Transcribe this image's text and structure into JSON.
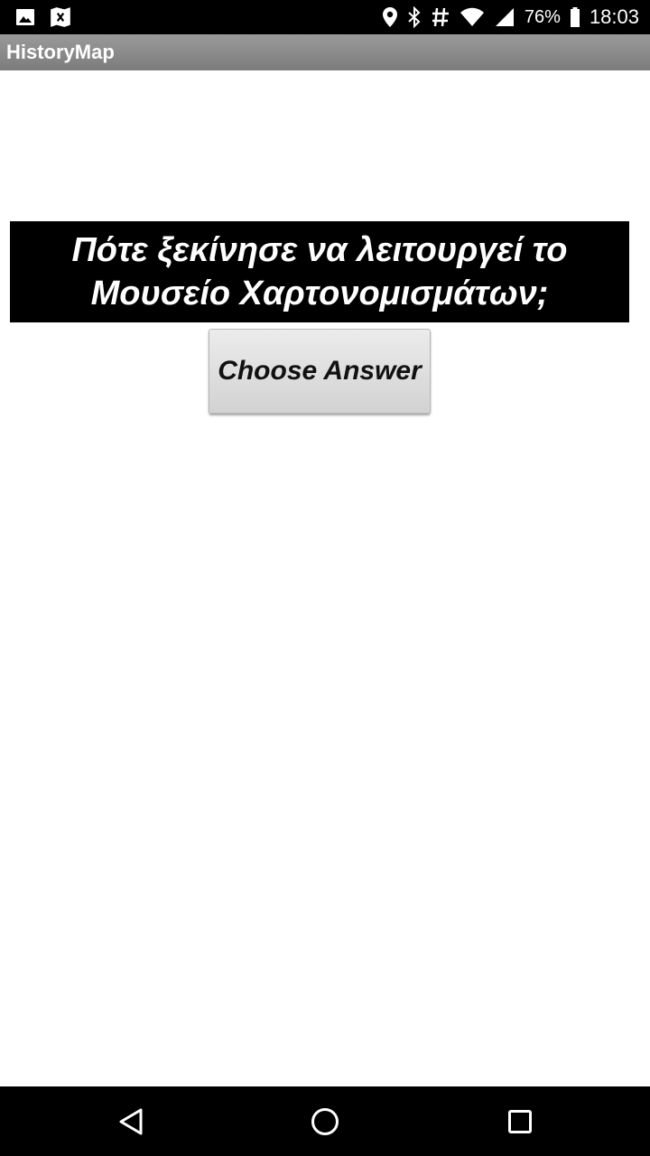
{
  "status_bar": {
    "battery_percent": "76%",
    "time": "18:03",
    "left_icons": [
      "image-icon",
      "map-icon"
    ],
    "right_icons": [
      "location-icon",
      "bluetooth-icon",
      "hash-icon",
      "wifi-icon",
      "signal-icon"
    ]
  },
  "app_bar": {
    "title": "HistoryMap"
  },
  "question": {
    "text": "Πότε ξεκίνησε να λειτουργεί το Μουσείο Χαρτονομισμάτων;"
  },
  "answer_button": {
    "label": "Choose Answer"
  },
  "nav_bar": {
    "icons": [
      "back-icon",
      "home-icon",
      "recents-icon"
    ]
  },
  "colors": {
    "status_bar_bg": "#000000",
    "app_bar_bg": "#8a8a8a",
    "question_bg": "#000000",
    "question_text": "#ffffff",
    "page_bg": "#ffffff"
  }
}
